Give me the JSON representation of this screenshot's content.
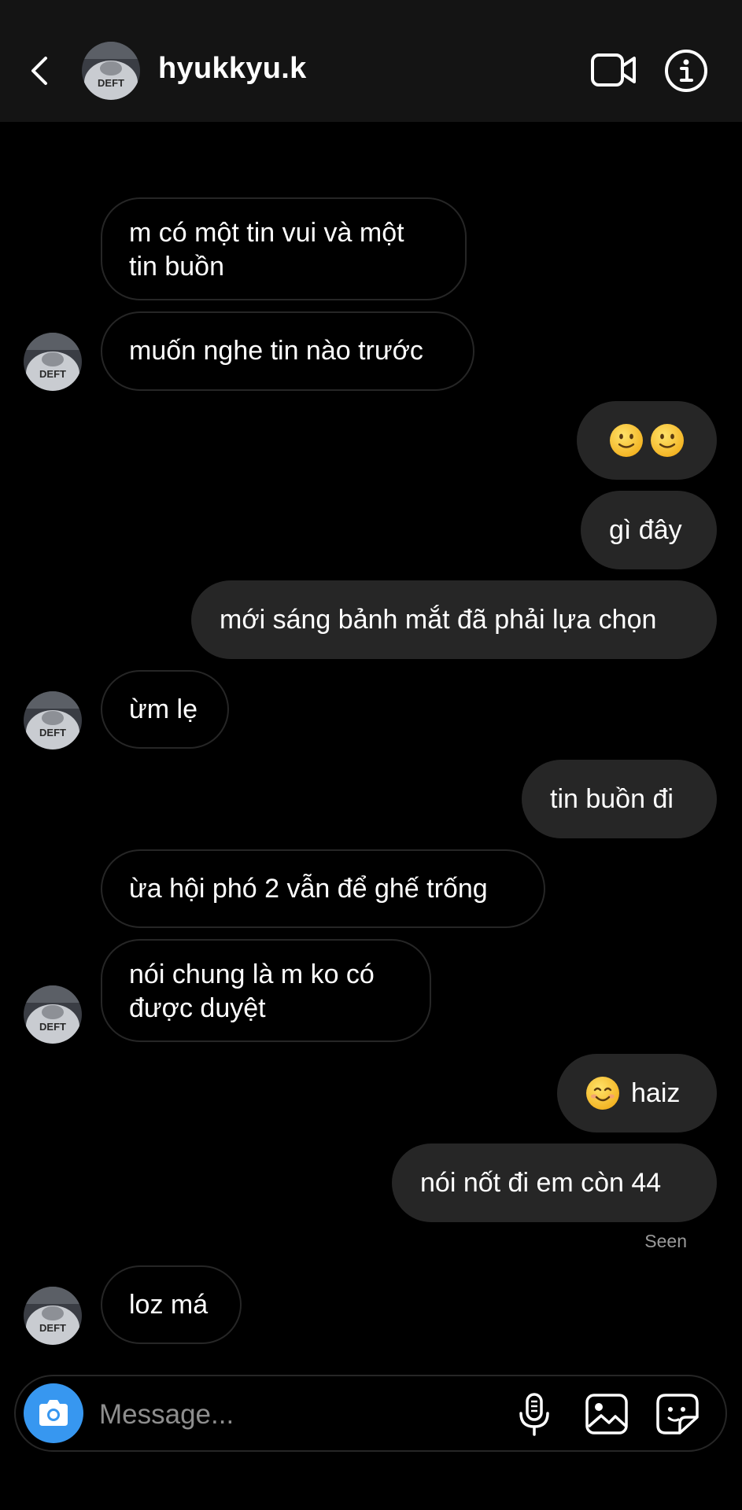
{
  "header": {
    "username": "hyukkyu.k",
    "avatar_caption": "DEFT"
  },
  "messages": [
    {
      "side": "in",
      "lines": [
        "m có một tin vui và một",
        "tin buồn"
      ]
    },
    {
      "side": "in",
      "text": "muốn nghe tin nào trước"
    },
    {
      "side": "out",
      "emojis": [
        "slightly-smiling-face",
        "slightly-smiling-face"
      ]
    },
    {
      "side": "out",
      "text": "gì đây"
    },
    {
      "side": "out",
      "text": "mới sáng bảnh mắt đã phải lựa chọn"
    },
    {
      "side": "in",
      "text": "ừm lẹ"
    },
    {
      "side": "out",
      "text": "tin buồn đi"
    },
    {
      "side": "in",
      "text": "ừa hội phó 2 vẫn để ghế trống"
    },
    {
      "side": "in",
      "lines": [
        "nói chung là m ko có",
        "được duyệt"
      ]
    },
    {
      "side": "out",
      "emoji": "smiling-face-with-smiling-eyes",
      "text": "haiz"
    },
    {
      "side": "out",
      "text": "nói nốt đi em còn 44"
    },
    {
      "side": "in",
      "text": "loz má"
    }
  ],
  "status": {
    "seen": "Seen"
  },
  "composer": {
    "placeholder": "Message..."
  },
  "colors": {
    "background": "#000000",
    "header_bg": "#141414",
    "outgoing_bubble": "#262626",
    "incoming_border": "#262626",
    "camera_button": "#3797f0",
    "muted_text": "#8e8e8e"
  },
  "icons": [
    "back-chevron-icon",
    "video-call-icon",
    "info-icon",
    "camera-icon",
    "microphone-icon",
    "gallery-icon",
    "sticker-icon"
  ]
}
